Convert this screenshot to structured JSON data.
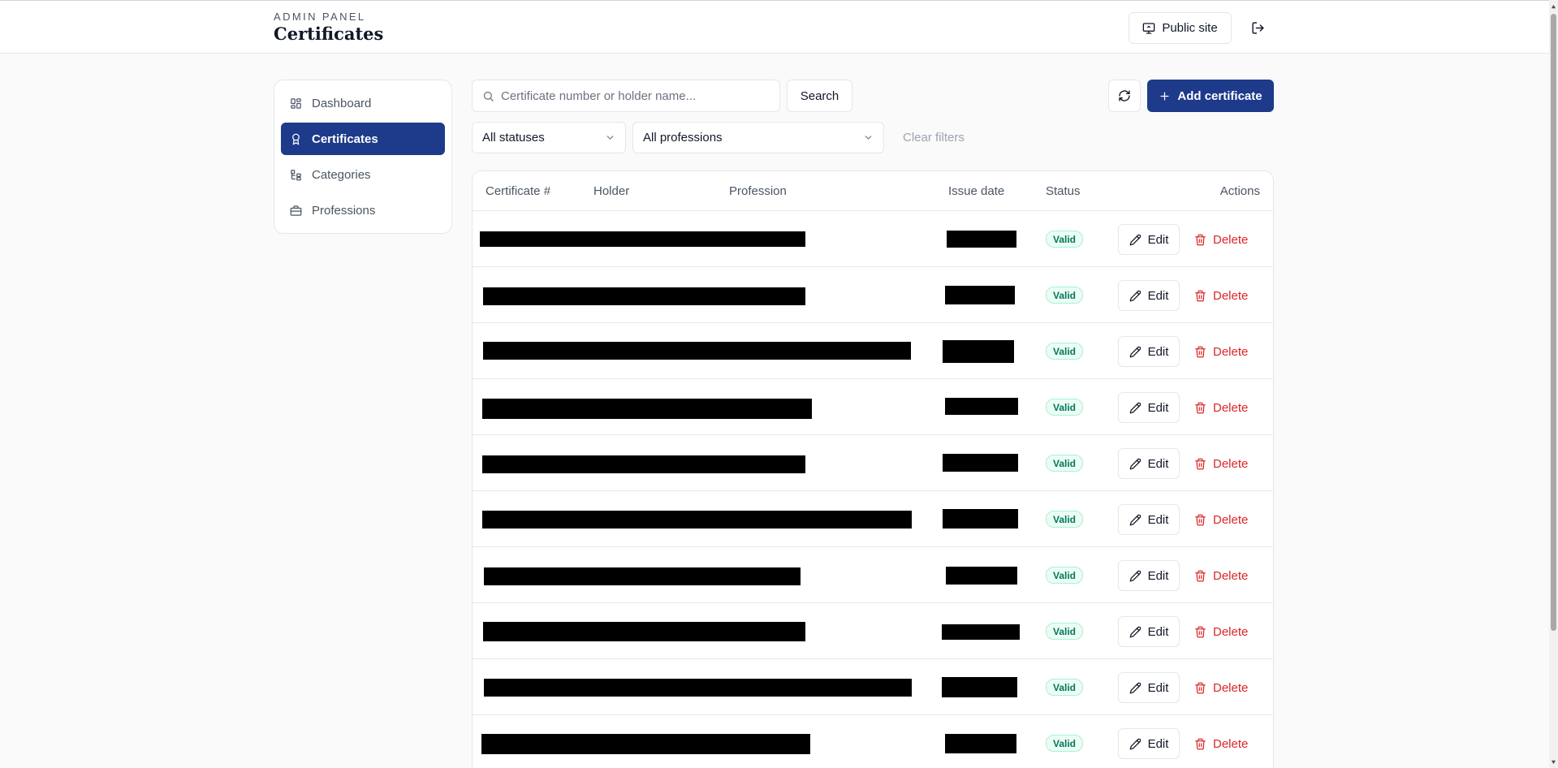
{
  "header": {
    "eyebrow": "ADMIN PANEL",
    "title": "Certificates",
    "public_site_label": "Public site"
  },
  "sidebar": {
    "items": [
      {
        "label": "Dashboard",
        "icon": "dashboard-icon",
        "active": false
      },
      {
        "label": "Certificates",
        "icon": "award-icon",
        "active": true
      },
      {
        "label": "Categories",
        "icon": "categories-icon",
        "active": false
      },
      {
        "label": "Professions",
        "icon": "briefcase-icon",
        "active": false
      }
    ]
  },
  "toolbar": {
    "search_placeholder": "Certificate number or holder name...",
    "search_value": "",
    "search_label": "Search",
    "add_label": "Add certificate",
    "status_filter": "All statuses",
    "profession_filter": "All professions",
    "clear_label": "Clear filters"
  },
  "table": {
    "columns": [
      "Certificate #",
      "Holder",
      "Profession",
      "Issue date",
      "Status",
      "Actions"
    ],
    "edit_label": "Edit",
    "delete_label": "Delete",
    "rows": [
      {
        "status": "Valid"
      },
      {
        "status": "Valid"
      },
      {
        "status": "Valid"
      },
      {
        "status": "Valid"
      },
      {
        "status": "Valid"
      },
      {
        "status": "Valid"
      },
      {
        "status": "Valid"
      },
      {
        "status": "Valid"
      },
      {
        "status": "Valid"
      },
      {
        "status": "Valid"
      }
    ]
  },
  "colors": {
    "primary": "#1e3a8a",
    "badge_text": "#047857",
    "badge_bg": "#ecfdf5",
    "danger": "#dc2626"
  }
}
